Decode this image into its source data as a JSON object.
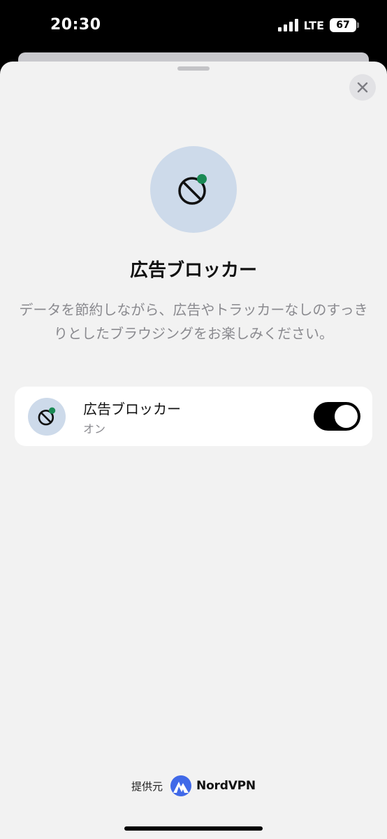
{
  "status_bar": {
    "time": "20:30",
    "network": "LTE",
    "battery": "67"
  },
  "hero": {
    "title": "広告ブロッカー",
    "description": "データを節約しながら、広告やトラッカーなしのすっきりとしたブラウジングをお楽しみください。"
  },
  "setting": {
    "label": "広告ブロッカー",
    "state_label": "オン",
    "enabled": true
  },
  "footer": {
    "provided_by": "提供元",
    "brand": "NordVPN"
  },
  "icons": {
    "close": "close-icon",
    "ad_blocker": "ad-blocker-icon",
    "brand_logo": "nordvpn-logo-icon"
  },
  "colors": {
    "sheet_background": "#f2f2f2",
    "icon_circle": "#cddaea",
    "status_dot": "#1a8a55",
    "toggle_on": "#000000",
    "secondary_text": "#8a8a8f",
    "brand_blue": "#4069e8"
  }
}
